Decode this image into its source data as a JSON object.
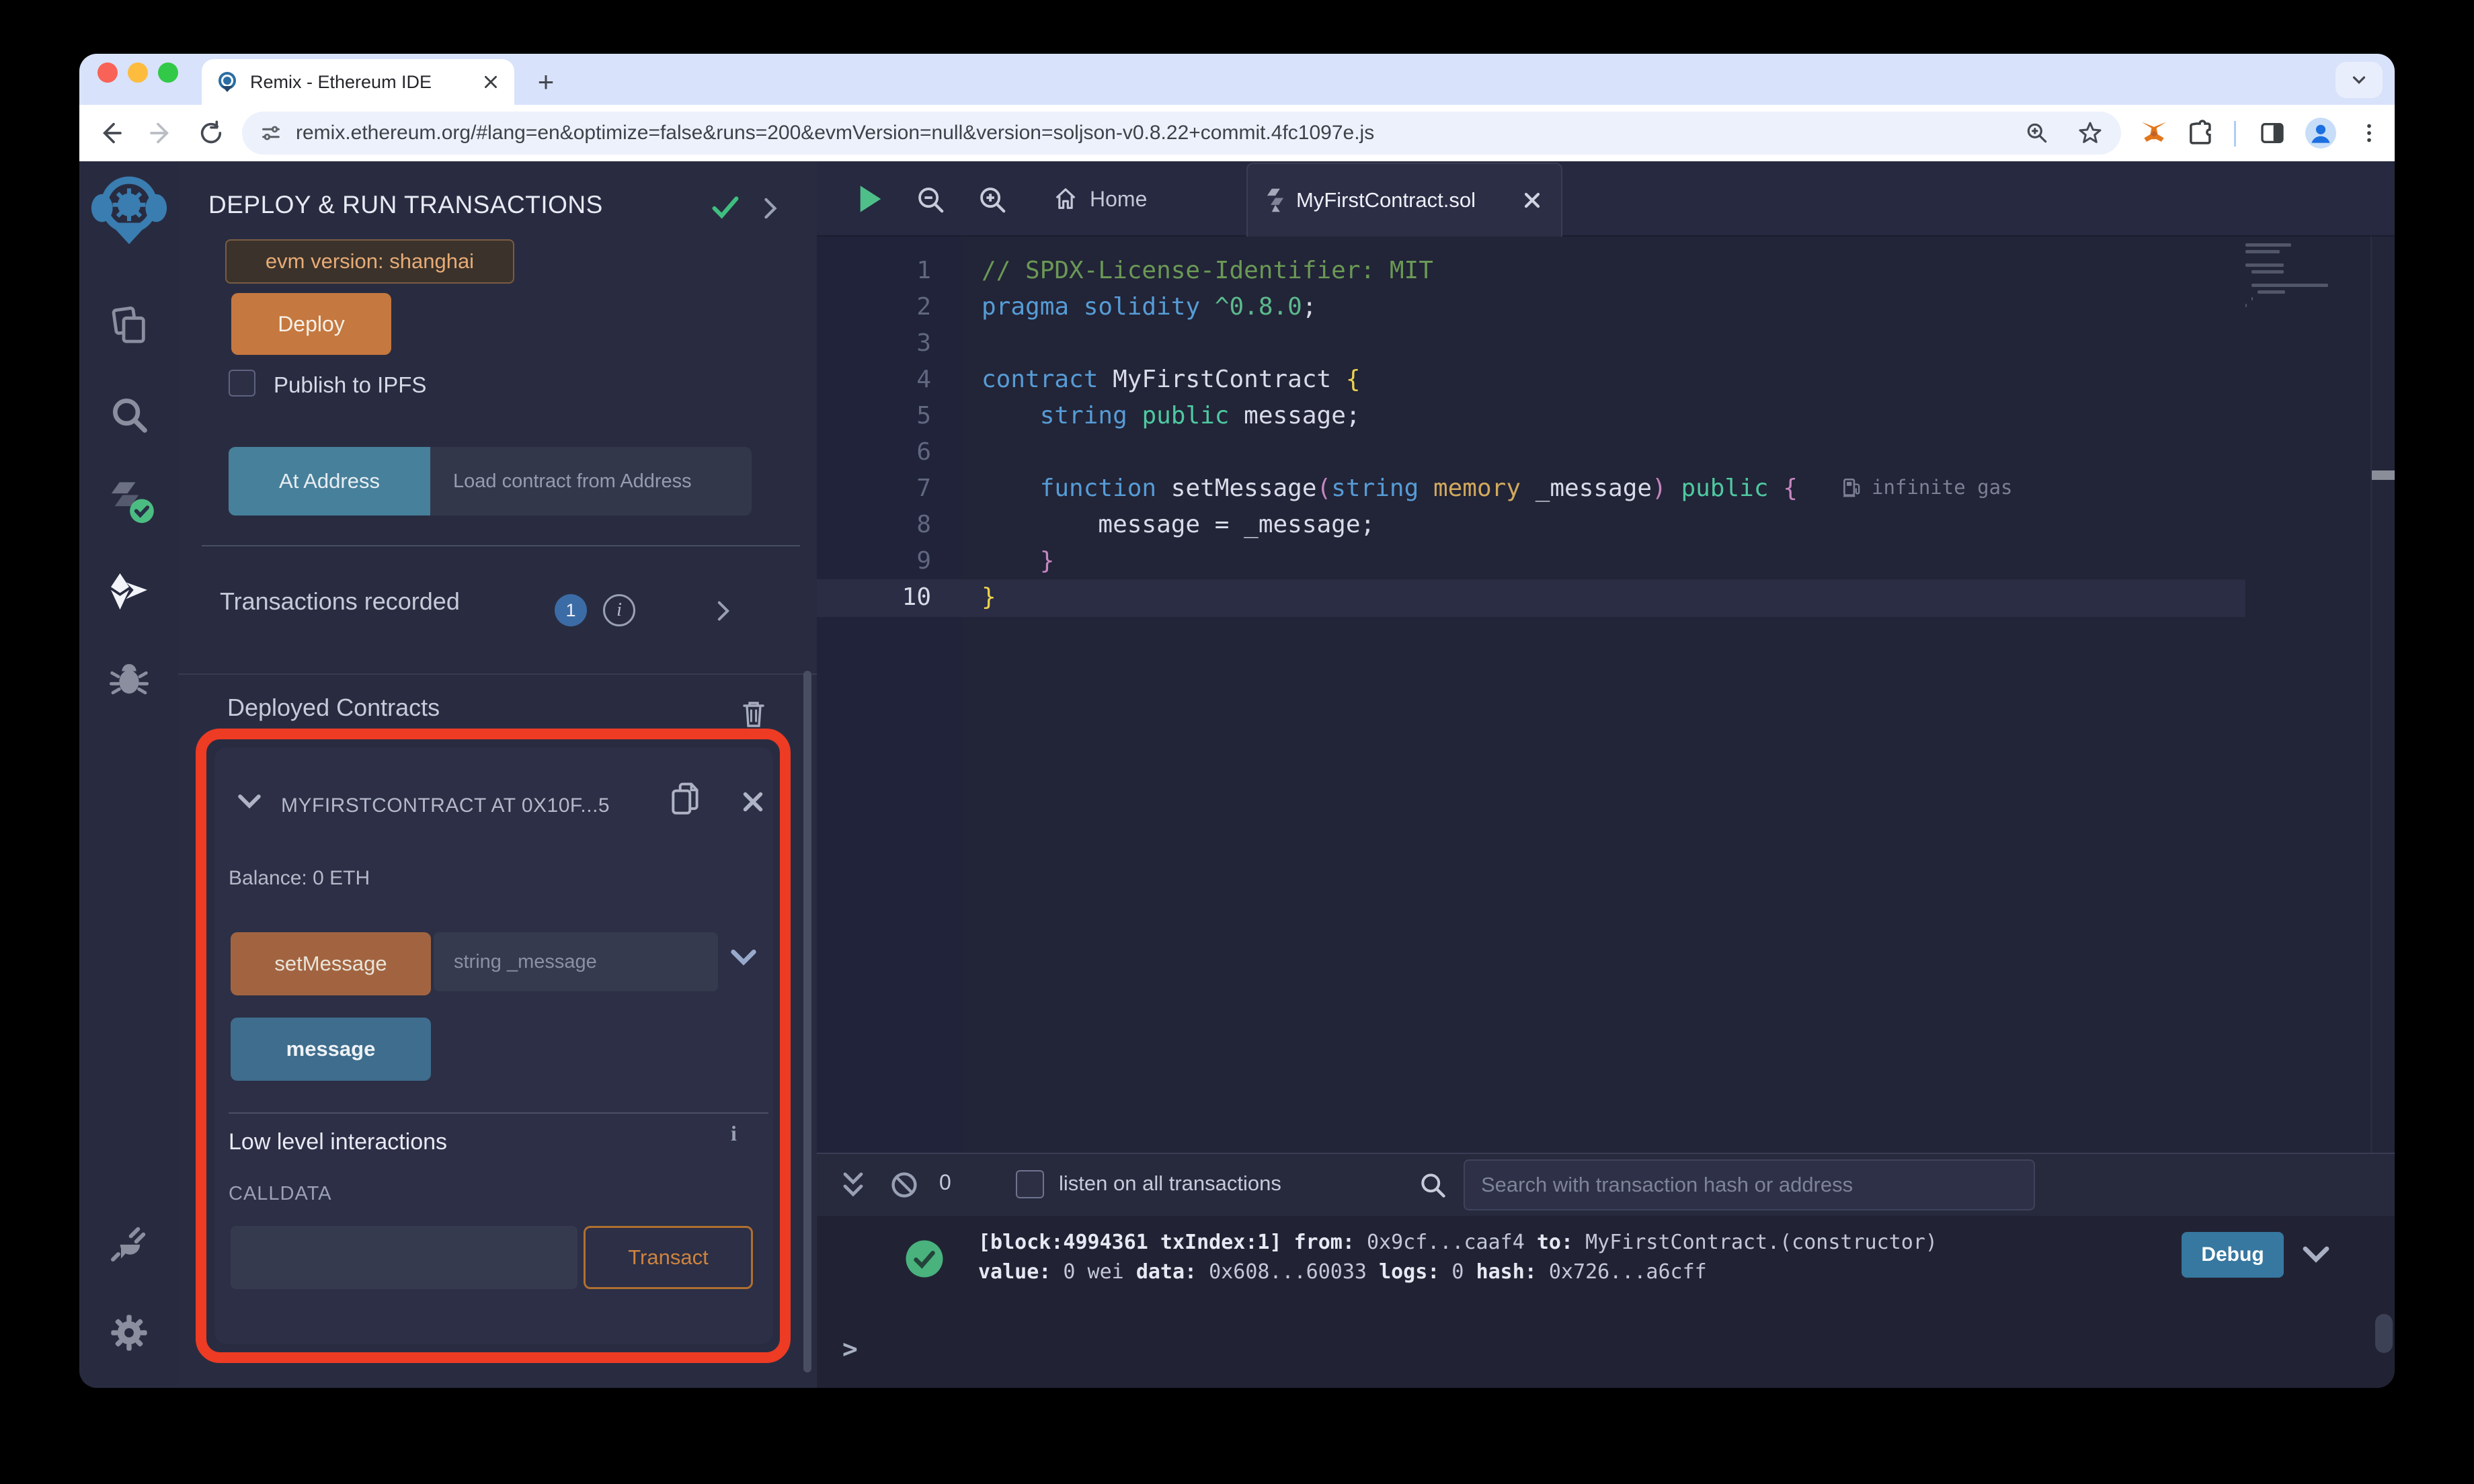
{
  "browser": {
    "tab_title": "Remix - Ethereum IDE",
    "url": "remix.ethereum.org/#lang=en&optimize=false&runs=200&evmVersion=null&version=soljson-v0.8.22+commit.4fc1097e.js"
  },
  "side_panel": {
    "title": "DEPLOY & RUN TRANSACTIONS",
    "evm_badge": "evm version: shanghai",
    "deploy_label": "Deploy",
    "publish_label": "Publish to IPFS",
    "at_address_label": "At Address",
    "at_address_placeholder": "Load contract from Address",
    "transactions_recorded_label": "Transactions recorded",
    "transactions_count": "1",
    "deployed_contracts_label": "Deployed Contracts",
    "contract": {
      "title": "MYFIRSTCONTRACT AT 0X10F...5",
      "balance": "Balance: 0 ETH",
      "set_message_label": "setMessage",
      "set_message_placeholder": "string _message",
      "message_label": "message",
      "low_level_title": "Low level interactions",
      "calldata_label": "CALLDATA",
      "transact_label": "Transact"
    }
  },
  "editor": {
    "home_tab_label": "Home",
    "file_tab_label": "MyFirstContract.sol",
    "gas_annotation": "infinite gas",
    "code_lines": [
      {
        "tokens": [
          [
            "// SPDX-License-Identifier: MIT",
            "cm"
          ]
        ]
      },
      {
        "tokens": [
          [
            "pragma",
            "kw"
          ],
          [
            " ",
            "pl"
          ],
          [
            "solidity",
            "kw"
          ],
          [
            " ",
            "pl"
          ],
          [
            "^0.8.0",
            "ver"
          ],
          [
            ";",
            "pl"
          ]
        ]
      },
      {
        "tokens": []
      },
      {
        "tokens": [
          [
            "contract",
            "kw"
          ],
          [
            " ",
            "pl"
          ],
          [
            "MyFirstContract",
            "pl"
          ],
          [
            " ",
            "pl"
          ],
          [
            "{",
            "by"
          ]
        ]
      },
      {
        "tokens": [
          [
            "    ",
            "pl"
          ],
          [
            "string",
            "kw"
          ],
          [
            " ",
            "pl"
          ],
          [
            "public",
            "kg"
          ],
          [
            " ",
            "pl"
          ],
          [
            "message",
            "pl"
          ],
          [
            ";",
            "pl"
          ]
        ]
      },
      {
        "tokens": []
      },
      {
        "tokens": [
          [
            "    ",
            "pl"
          ],
          [
            "function",
            "kw"
          ],
          [
            " ",
            "pl"
          ],
          [
            "setMessage",
            "pl"
          ],
          [
            "(",
            "bp"
          ],
          [
            "string",
            "kw"
          ],
          [
            " ",
            "pl"
          ],
          [
            "memory",
            "gold"
          ],
          [
            " ",
            "pl"
          ],
          [
            "_message",
            "pl"
          ],
          [
            ")",
            "bp"
          ],
          [
            " ",
            "pl"
          ],
          [
            "public",
            "kg"
          ],
          [
            " ",
            "pl"
          ],
          [
            "{",
            "bp"
          ]
        ]
      },
      {
        "tokens": [
          [
            "        ",
            "pl"
          ],
          [
            "message",
            "pl"
          ],
          [
            " = ",
            "pl"
          ],
          [
            "_message",
            "pl"
          ],
          [
            ";",
            "pl"
          ]
        ]
      },
      {
        "tokens": [
          [
            "    ",
            "pl"
          ],
          [
            "}",
            "bp"
          ]
        ]
      },
      {
        "tokens": [
          [
            "}",
            "by"
          ]
        ]
      }
    ],
    "current_line": 10
  },
  "terminal": {
    "pending_count": "0",
    "listen_label": "listen on all transactions",
    "search_placeholder": "Search with transaction hash or address",
    "log_lines": [
      [
        [
          "[block:4994361 txIndex:1]",
          true
        ],
        [
          " ",
          false
        ],
        [
          "from:",
          true
        ],
        [
          " 0x9cf...caaf4 ",
          false
        ],
        [
          "to:",
          true
        ],
        [
          " MyFirstContract.(constructor)",
          false
        ]
      ],
      [
        [
          "value:",
          true
        ],
        [
          " 0 wei ",
          false
        ],
        [
          "data:",
          true
        ],
        [
          " 0x608...60033 ",
          false
        ],
        [
          "logs:",
          true
        ],
        [
          " 0 ",
          false
        ],
        [
          "hash:",
          true
        ],
        [
          " 0x726...a6cff",
          false
        ]
      ]
    ],
    "debug_label": "Debug",
    "prompt": ">"
  },
  "colors": {
    "annotation_red": "#ee3b24",
    "deploy_orange": "#c5783f",
    "set_message_brown": "#a26440",
    "message_teal": "#3e6d8d",
    "at_address_teal": "#47809b",
    "debug_blue": "#3778a0",
    "badge_blue": "#3c6ca6",
    "check_green": "#49b27d"
  }
}
